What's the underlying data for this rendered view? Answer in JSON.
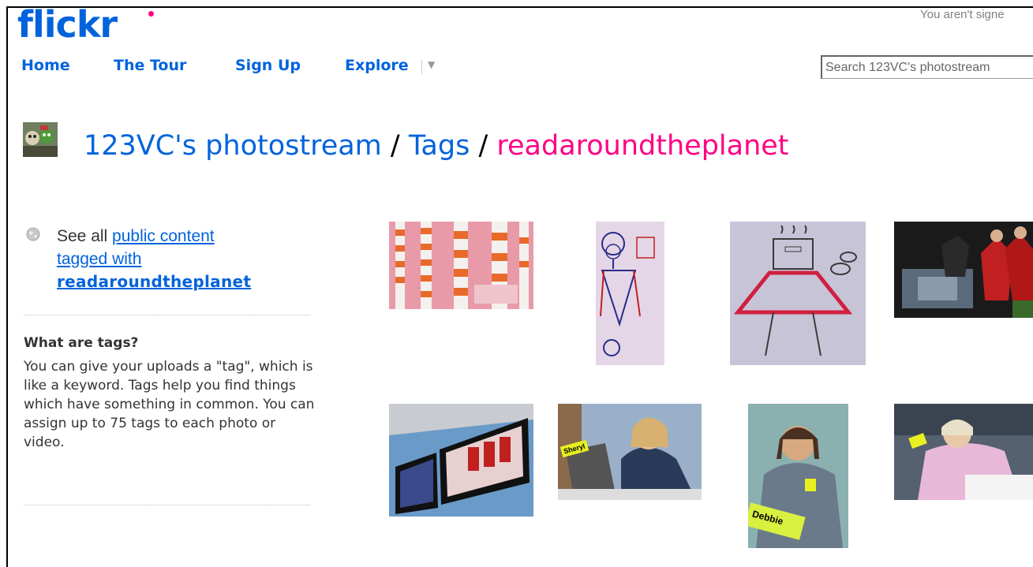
{
  "header": {
    "logo": "flickr",
    "signin_text": "You aren't signe",
    "nav": [
      {
        "label": "Home"
      },
      {
        "label": "The Tour"
      },
      {
        "label": "Sign Up"
      },
      {
        "label": "Explore"
      }
    ],
    "search_placeholder": "Search 123VC's photostream"
  },
  "title": {
    "user": "123VC's photostream",
    "sep1": " / ",
    "tags": "Tags",
    "sep2": " / ",
    "tag": "readaroundtheplanet"
  },
  "sidebar": {
    "see_all_prefix": "See all ",
    "see_all_link1": "public content",
    "see_all_link2": "tagged with",
    "see_all_tag": "readaroundtheplanet",
    "what_heading": "What are tags?",
    "what_body": "You can give your uploads a \"tag\", which is like a keyword. Tags help you find things which have something in common. You can assign up to 75 tags to each photo or video."
  },
  "photos": [
    {
      "name": "photo-pink-cones",
      "badge": ""
    },
    {
      "name": "photo-drawing-girl",
      "badge": ""
    },
    {
      "name": "photo-drawing-robot",
      "badge": ""
    },
    {
      "name": "photo-graduation",
      "badge": ""
    },
    {
      "name": "photo-tv-screens",
      "badge": ""
    },
    {
      "name": "photo-woman-laptop",
      "badge": "Sheryl"
    },
    {
      "name": "photo-woman-debbie",
      "badge": "Debbie"
    },
    {
      "name": "photo-woman-writing",
      "badge": ""
    }
  ],
  "colors": {
    "flickr_blue": "#0063dc",
    "flickr_pink": "#ff0084"
  }
}
